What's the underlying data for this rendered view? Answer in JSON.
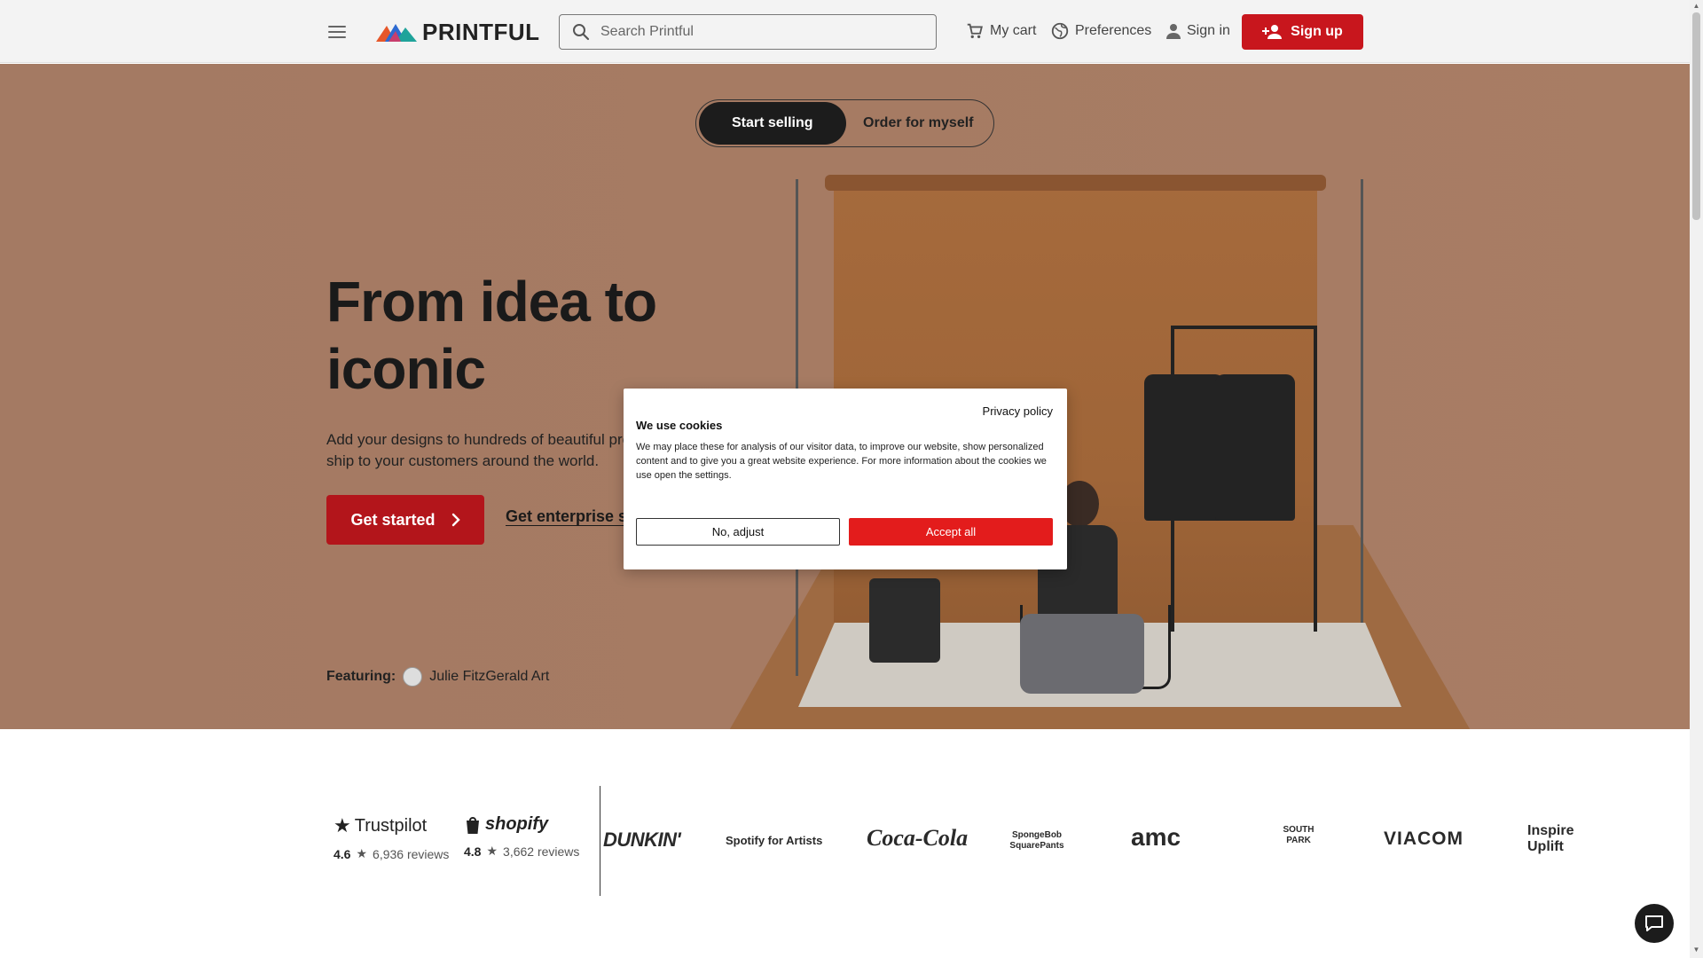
{
  "header": {
    "logo_text": "PRINTFUL",
    "search_placeholder": "Search Printful",
    "cart_label": "My cart",
    "preferences_label": "Preferences",
    "signin_label": "Sign in",
    "signup_label": "Sign up",
    "accent_color": "#c8161d"
  },
  "hero": {
    "toggle": {
      "active": "Start selling",
      "inactive": "Order for myself"
    },
    "title": "From idea to iconic",
    "subtitle": "Add your designs to hundreds of beautiful products and we ship to your customers around the world.",
    "cta_primary": "Get started",
    "cta_secondary": "Get enterprise solutions",
    "featuring_label": "Featuring:",
    "featuring_name": "Julie FitzGerald Art"
  },
  "reviews": [
    {
      "brand": "Trustpilot",
      "rating": "4.6",
      "count": "6,936 reviews"
    },
    {
      "brand": "shopify",
      "rating": "4.8",
      "count": "3,662 reviews"
    }
  ],
  "brands": [
    "DUNKIN'",
    "Spotify for Artists",
    "Coca-Cola",
    "SpongeBob SquarePants",
    "amc",
    "SOUTH PARK",
    "VIACOM",
    "Inspire Uplift"
  ],
  "cookie": {
    "policy_link": "Privacy policy",
    "title": "We use cookies",
    "body": "We may place these for analysis of our visitor data, to improve our website, show personalized content and to give you a great website experience. For more information about the cookies we use open the settings.",
    "adjust_label": "No, adjust",
    "accept_label": "Accept all"
  }
}
